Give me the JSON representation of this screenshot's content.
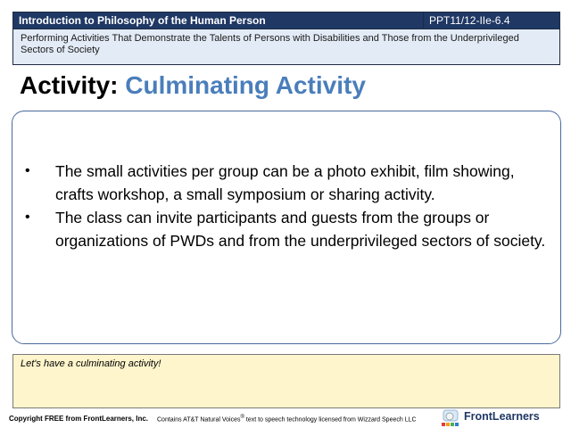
{
  "header": {
    "course_title": "Introduction to Philosophy of the Human Person",
    "course_code": "PPT11/12-IIe-6.4",
    "subtitle": "Performing Activities That Demonstrate the Talents of Persons with Disabilities and Those from the Underprivileged Sectors of Society"
  },
  "slide": {
    "title_prefix": "Activity:",
    "title_accent": "Culminating Activity",
    "bullet_symbol": "•",
    "bullets": [
      "The small activities per group can be a photo exhibit, film showing, crafts workshop, a small symposium or sharing activity.",
      "The class can invite participants and guests from the groups or organizations of PWDs and from the underprivileged  sectors of society."
    ]
  },
  "note": {
    "text": "Let's have a culminating activity!"
  },
  "footer": {
    "copyright": "Copyright FREE from FrontLearners, Inc.",
    "tts_before": "Contains AT&T Natural Voices",
    "tts_mark": "®",
    "tts_after": " text to speech technology licensed from Wizzard Speech LLC",
    "logo_text": "FrontLearners"
  },
  "colors": {
    "header_bg": "#1f3864",
    "title_accent": "#4a7ebb",
    "note_bg": "#fff5cc",
    "subtitle_bg": "#e3ebf6"
  },
  "icons": {
    "logo": "frontlearners-logo-icon"
  }
}
